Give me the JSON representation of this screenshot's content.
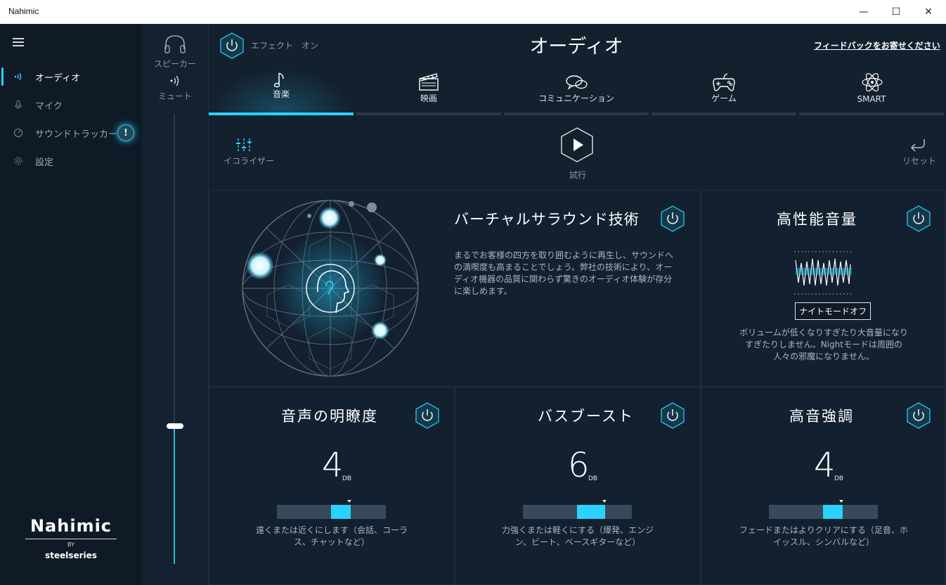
{
  "window": {
    "title": "Nahimic",
    "minimize": "—",
    "maximize": "☐",
    "close": "✕"
  },
  "sidebar": {
    "items": [
      {
        "label": "オーディオ",
        "icon": "sound-waves-icon"
      },
      {
        "label": "マイク",
        "icon": "microphone-icon"
      },
      {
        "label": "サウンドトラッカー",
        "icon": "tracker-gauge-icon"
      },
      {
        "label": "設定",
        "icon": "gear-icon"
      }
    ],
    "alert_badge": "!",
    "brand": {
      "logo": "Nahimic",
      "by": "BY",
      "partner": "steelseries"
    }
  },
  "volume": {
    "device_label": "スピーカー",
    "mute_label": "ミュート",
    "level": 0.3
  },
  "header": {
    "effect_label": "エフェクト　オン",
    "title": "オーディオ",
    "feedback": "フィードバックをお寄せください"
  },
  "tabs": [
    {
      "label": "音楽",
      "icon": "music-note-icon",
      "active": true
    },
    {
      "label": "映画",
      "icon": "clapperboard-icon",
      "active": false
    },
    {
      "label": "コミュニケーション",
      "icon": "chat-bubbles-icon",
      "active": false
    },
    {
      "label": "ゲーム",
      "icon": "gamepad-icon",
      "active": false
    },
    {
      "label": "SMART",
      "icon": "atom-icon",
      "active": false
    }
  ],
  "toolbar": {
    "equalizer": "イコライザー",
    "preview": "試行",
    "reset": "リセット"
  },
  "surround": {
    "title": "バーチャルサラウンド技術",
    "description": "まるでお客様の四方を取り囲むように再生し、サウンドへの満喫度も高まることでしょう。弊社の技術により、オーディオ機器の品質に関わらず驚きのオーディオ体験が存分に楽しめます。"
  },
  "volume_boost": {
    "title": "高性能音量",
    "night_button": "ナイトモードオフ",
    "description": "ボリュームが低くなりすぎたり大音量になりすぎたりしません。Nightモードは周囲の人々の邪魔になりません。"
  },
  "voice": {
    "title": "音声の明瞭度",
    "value": "4",
    "unit": "DB",
    "description": "遠くまたは近くにします（会話、コーラス、チャットなど）"
  },
  "bass": {
    "title": "バスブースト",
    "value": "6",
    "unit": "DB",
    "description": "力強くまたは軽くにする（爆発、エンジン、ビート、ベースギターなど）"
  },
  "treble": {
    "title": "高音強調",
    "value": "4",
    "unit": "DB",
    "description": "フェードまたはよりクリアにする（足音、ホイッスル、シンバルなど）"
  },
  "colors": {
    "accent": "#2ad3ff",
    "bg": "#13202e",
    "sidebar": "#0f1a26"
  }
}
